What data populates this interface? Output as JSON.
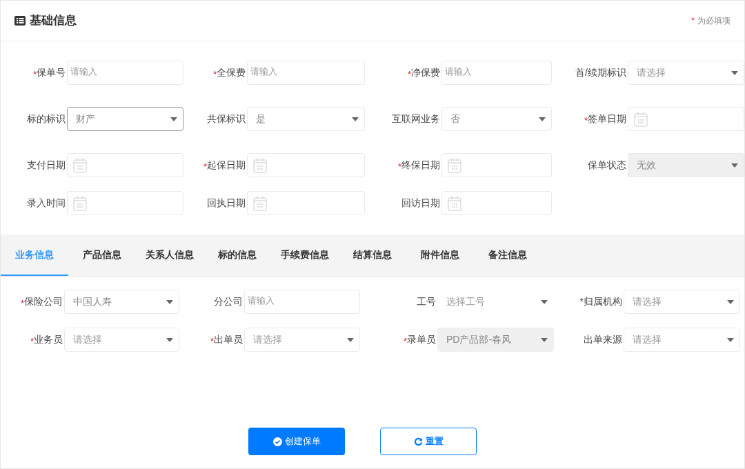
{
  "header": {
    "title": "基础信息",
    "required_note": "为必填项",
    "required_mark": "*"
  },
  "basic_fields": [
    {
      "label": "保单号",
      "required": true,
      "kind": "input",
      "placeholder": "请输入",
      "focused": false,
      "disabled": false
    },
    {
      "label": "全保费",
      "required": true,
      "kind": "input",
      "placeholder": "请输入",
      "focused": false,
      "disabled": false
    },
    {
      "label": "净保费",
      "required": true,
      "kind": "input",
      "placeholder": "请输入",
      "focused": false,
      "disabled": false
    },
    {
      "label": "首/续期标识",
      "required": false,
      "kind": "select",
      "placeholder": "请选择",
      "focused": false,
      "disabled": false
    },
    {
      "label": "标的标识",
      "required": false,
      "kind": "select",
      "value": "财产",
      "focused": true,
      "disabled": false
    },
    {
      "label": "共保标识",
      "required": false,
      "kind": "select",
      "value": "是",
      "focused": false,
      "disabled": false
    },
    {
      "label": "互联网业务",
      "required": false,
      "kind": "select",
      "value": "否",
      "focused": false,
      "disabled": false
    },
    {
      "label": "签单日期",
      "required": true,
      "kind": "date",
      "focused": false,
      "disabled": false
    },
    {
      "label": "支付日期",
      "required": false,
      "kind": "date",
      "focused": false,
      "disabled": false
    },
    {
      "label": "起保日期",
      "required": true,
      "kind": "date",
      "focused": false,
      "disabled": false
    },
    {
      "label": "终保日期",
      "required": true,
      "kind": "date",
      "focused": false,
      "disabled": false
    },
    {
      "label": "保单状态",
      "required": false,
      "kind": "select",
      "value": "无效",
      "focused": false,
      "disabled": true
    },
    {
      "label": "录入时间",
      "required": false,
      "kind": "date",
      "focused": false,
      "disabled": false
    },
    {
      "label": "回执日期",
      "required": false,
      "kind": "date",
      "focused": false,
      "disabled": false
    },
    {
      "label": "回访日期",
      "required": false,
      "kind": "date",
      "focused": false,
      "disabled": false
    }
  ],
  "tabs": [
    {
      "label": "业务信息",
      "selected": true
    },
    {
      "label": "产品信息",
      "selected": false
    },
    {
      "label": "关系人信息",
      "selected": false
    },
    {
      "label": "标的信息",
      "selected": false
    },
    {
      "label": "手续费信息",
      "selected": false
    },
    {
      "label": "结算信息",
      "selected": false
    },
    {
      "label": "附件信息",
      "selected": false
    },
    {
      "label": "备注信息",
      "selected": false
    }
  ],
  "business_fields": [
    {
      "label": "保险公司",
      "required": true,
      "kind": "select",
      "value": "中国人寿",
      "disabled": false,
      "bordered": true
    },
    {
      "label": "分公司",
      "required": false,
      "kind": "input",
      "placeholder": "请输入",
      "disabled": false,
      "bordered": true
    },
    {
      "label": "工号",
      "required": false,
      "kind": "select",
      "placeholder": "选择工号",
      "disabled": false,
      "bordered": false
    },
    {
      "label": "*归属机构",
      "required": false,
      "kind": "select",
      "placeholder": "请选择",
      "disabled": false,
      "bordered": true
    },
    {
      "label": "业务员",
      "required": true,
      "kind": "select",
      "placeholder": "请选择",
      "disabled": false,
      "bordered": true
    },
    {
      "label": "出单员",
      "required": true,
      "kind": "select",
      "placeholder": "请选择",
      "disabled": false,
      "bordered": true
    },
    {
      "label": "录单员",
      "required": true,
      "kind": "select",
      "value": "PD产品部-春风",
      "disabled": true,
      "bordered": false
    },
    {
      "label": "出单来源",
      "required": false,
      "kind": "select",
      "placeholder": "请选择",
      "disabled": false,
      "bordered": true
    }
  ],
  "buttons": [
    {
      "label": "创建保单",
      "kind": "primary"
    },
    {
      "label": "重置",
      "kind": "reset"
    }
  ]
}
